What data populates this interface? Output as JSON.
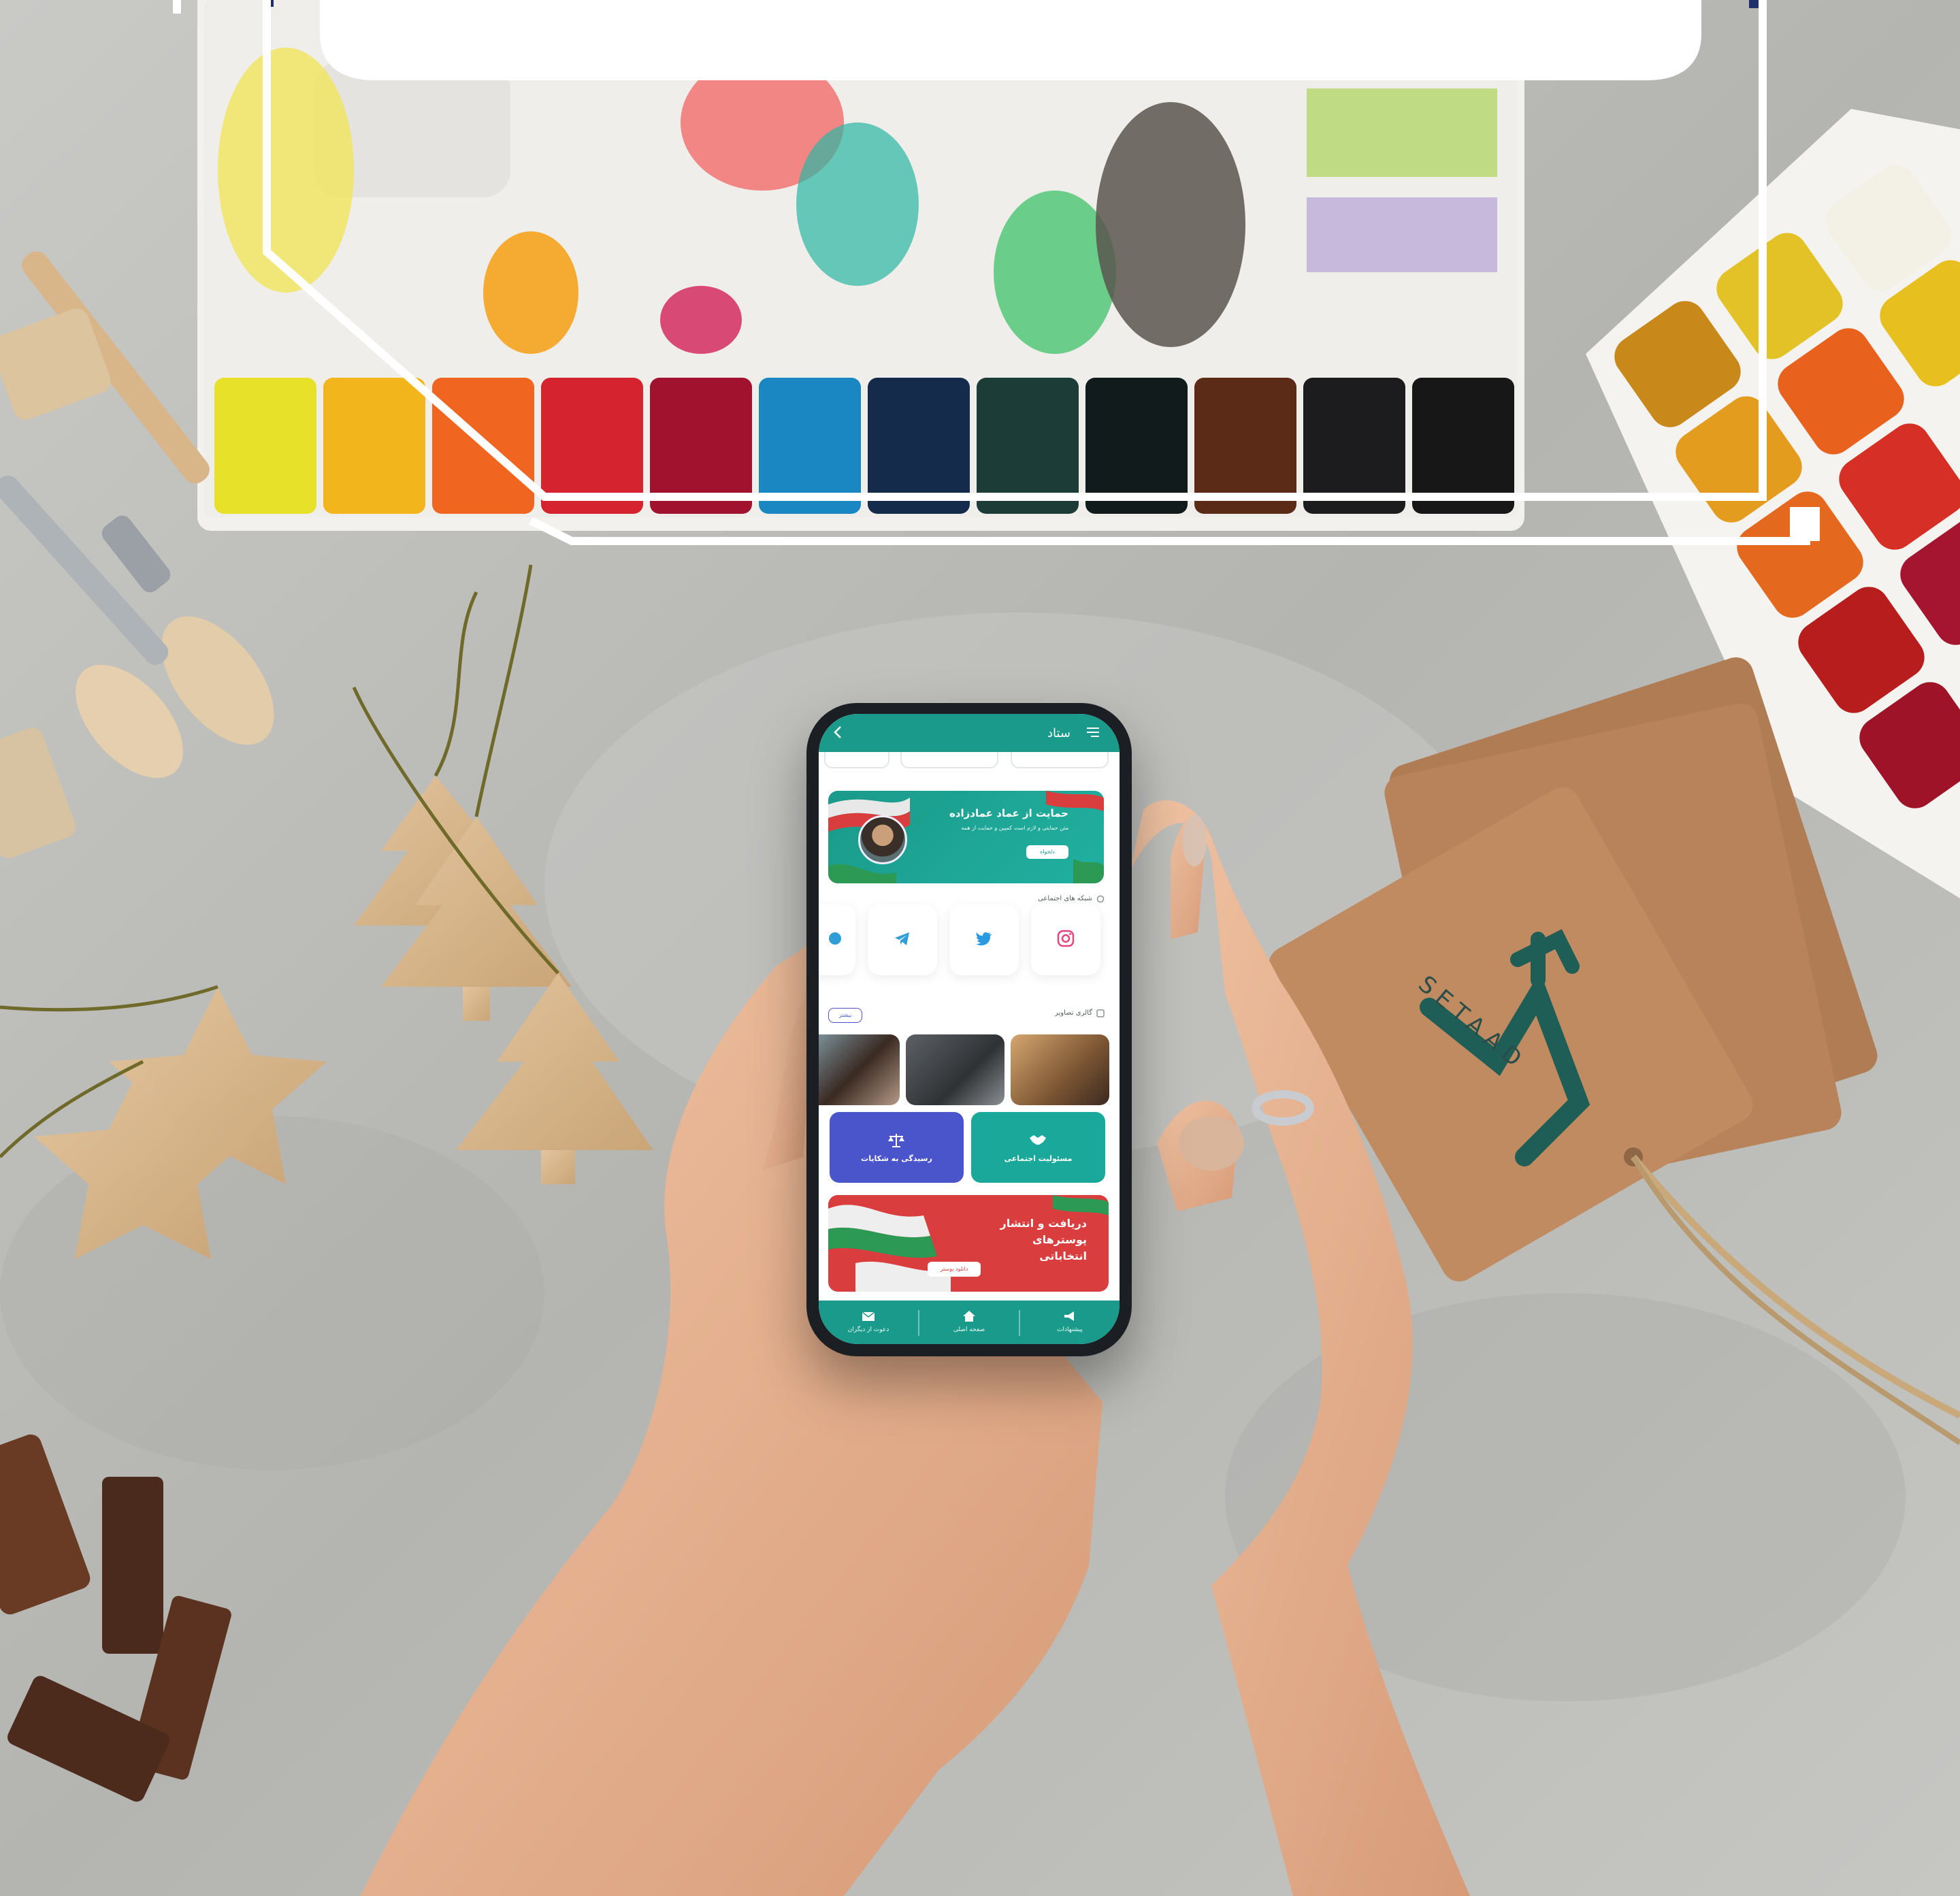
{
  "colors": {
    "teal": "#1a9a8a",
    "indigo": "#4a55cc",
    "red": "#d93d3d",
    "frame_white": "#ffffff",
    "frame_navy": "#1f2f6a",
    "card_brown": "#b8835a",
    "logo_green": "#1f5e56"
  },
  "card_logo": {
    "latin_text": "SETAAD"
  },
  "phone": {
    "topbar": {
      "title": "ستاد",
      "menu_icon": "hamburger-menu-icon",
      "back_icon": "chevron-left-icon"
    },
    "banner": {
      "title": "حمایت از عماد عمادزاده",
      "subtitle": "متن حمایتی و لازم است کمپین و حمایت از همه",
      "button": "دلخواه"
    },
    "social": {
      "label": "شبکه های اجتماعی",
      "items": [
        {
          "name": "Instagram",
          "icon": "instagram-icon"
        },
        {
          "name": "Twitter",
          "icon": "twitter-icon"
        },
        {
          "name": "Telegram",
          "icon": "telegram-icon"
        },
        {
          "name": "More",
          "icon": "circle-icon"
        }
      ]
    },
    "gallery": {
      "label": "گالری تصاویر",
      "more": "بیشتر"
    },
    "actions": [
      {
        "label": "مسئولیت اجتماعی",
        "icon": "handshake-icon",
        "color": "#1a9a8a"
      },
      {
        "label": "رسیدگی به شکایات",
        "icon": "scales-icon",
        "color": "#4a55cc"
      }
    ],
    "poster": {
      "title": "دریافت و انتشار پوسترهای انتخاباتی",
      "button": "دانلود پوستر"
    },
    "bottom_nav": [
      {
        "label": "پیشنهادات",
        "icon": "megaphone-icon"
      },
      {
        "label": "صفحه اصلی",
        "icon": "home-icon"
      },
      {
        "label": "دعوت از دیگران",
        "icon": "envelope-icon"
      }
    ]
  }
}
